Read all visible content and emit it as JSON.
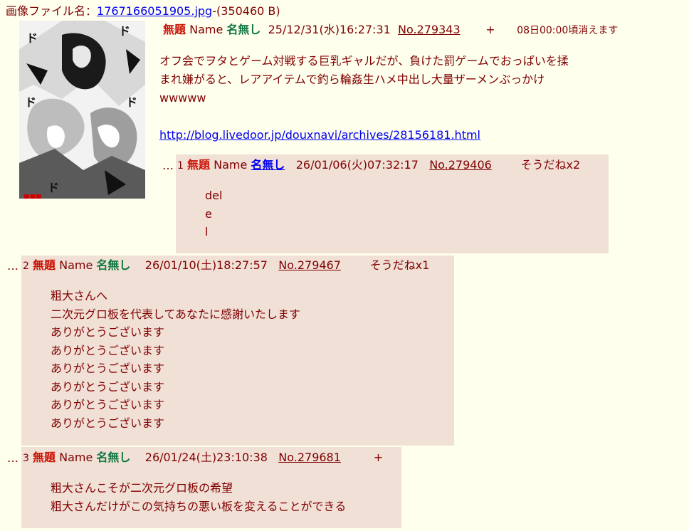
{
  "file": {
    "label": "画像ファイル名：",
    "name": "1767166051905.jpg",
    "size": "-(350460 B)"
  },
  "op": {
    "title": "無題",
    "name_label": "Name",
    "name": "名無し",
    "date": "25/12/31(水)16:27:31",
    "no": "No.279343",
    "plus": "+",
    "expire": "08日00:00頃消えます",
    "body_lines": [
      "オフ会でヲタとゲーム対戦する巨乳ギャルだが、負けた罰ゲームでおっぱいを揉",
      "まれ嫌がると、レアアイテムで釣ら輪姦生ハメ中出し大量ザーメンぶっかけ",
      "wwwww"
    ],
    "link": "http://blog.livedoor.jp/douxnavi/archives/28156181.html"
  },
  "replies": [
    {
      "dots": "…",
      "index": "1",
      "title": "無題",
      "name_label": "Name",
      "name": "名無し",
      "date": "26/01/06(火)07:32:17",
      "no": "No.279406",
      "extra": "そうだねx2",
      "lines": [
        "del",
        "e",
        "l"
      ]
    },
    {
      "dots": "…",
      "index": "2",
      "title": "無題",
      "name_label": "Name",
      "name": "名無し",
      "date": "26/01/10(土)18:27:57",
      "no": "No.279467",
      "extra": "そうだねx1",
      "lines": [
        "粗大さんへ",
        "二次元グロ板を代表してあなたに感謝いたします",
        "ありがとうございます",
        "ありがとうございます",
        "ありがとうございます",
        "ありがとうございます",
        "ありがとうございます",
        "ありがとうございます"
      ]
    },
    {
      "dots": "…",
      "index": "3",
      "title": "無題",
      "name_label": "Name",
      "name": "名無し",
      "date": "26/01/24(土)23:10:38",
      "no": "No.279681",
      "extra": "+",
      "lines": [
        "粗大さんこそが二次元グロ板の希望",
        "粗大さんだけがこの気持ちの悪い板を変えることができる"
      ]
    }
  ]
}
